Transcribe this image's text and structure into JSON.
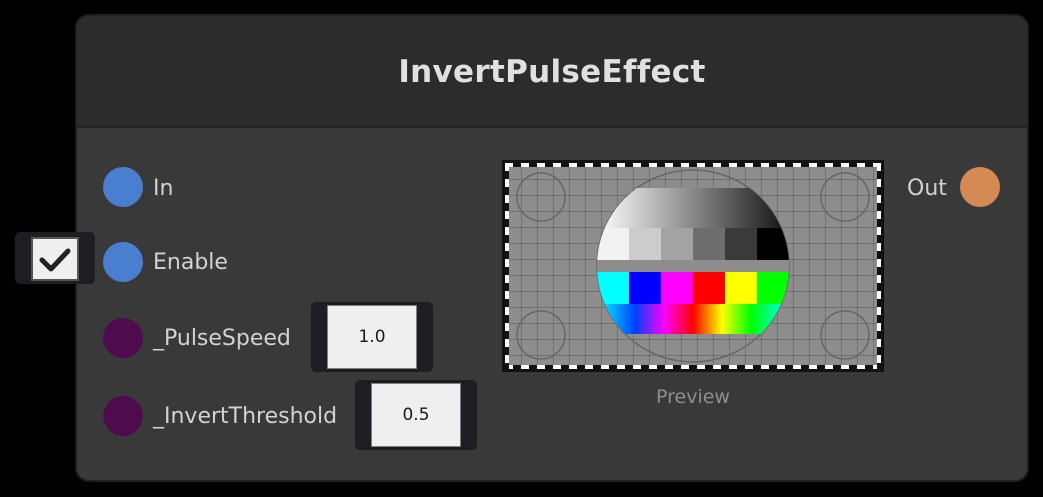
{
  "node": {
    "title": "InvertPulseEffect",
    "ports": {
      "in": {
        "label": "In",
        "color": "#4a7fd0"
      },
      "enable": {
        "label": "Enable",
        "color": "#4a7fd0",
        "checked": true
      },
      "pulse_speed": {
        "label": "_PulseSpeed",
        "color": "#4e0b4e",
        "value": "1.0"
      },
      "invert_threshold": {
        "label": "_InvertThreshold",
        "color": "#4e0b4e",
        "value": "0.5"
      },
      "out": {
        "label": "Out",
        "color": "#d58a55"
      }
    },
    "preview": {
      "label": "Preview"
    }
  },
  "colors": {
    "background": "#000000",
    "node_body": "#393939",
    "node_header": "#2c2c2c",
    "title_text": "#e0e0e0"
  },
  "icons": {
    "enable_checkbox": "checkmark-icon"
  }
}
